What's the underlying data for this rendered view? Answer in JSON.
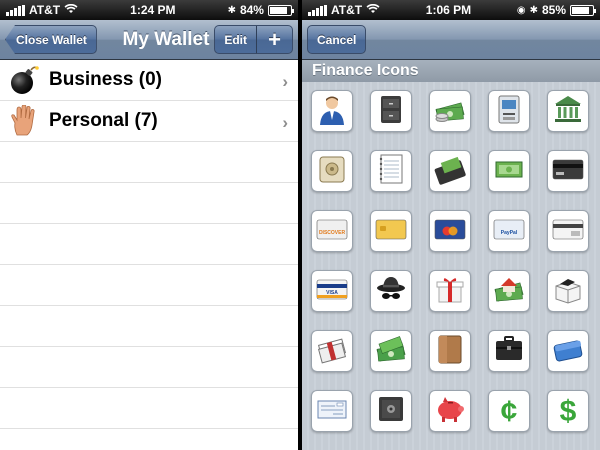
{
  "left": {
    "status": {
      "carrier": "AT&T",
      "time": "1:24 PM",
      "battery": "84%",
      "battery_level": 0.84
    },
    "nav": {
      "back_label": "Close Wallet",
      "title": "My Wallet",
      "edit_label": "Edit",
      "add_label": "+"
    },
    "rows": [
      {
        "label": "Business (0)",
        "icon": "bomb-icon"
      },
      {
        "label": "Personal (7)",
        "icon": "hand-icon"
      }
    ]
  },
  "right": {
    "status": {
      "carrier": "AT&T",
      "time": "1:06 PM",
      "battery": "85%",
      "battery_level": 0.85
    },
    "nav": {
      "cancel_label": "Cancel"
    },
    "section_title": "Finance Icons",
    "icons": [
      "businessman-icon",
      "safe-cabinet-icon",
      "money-coins-icon",
      "atm-icon",
      "bank-icon",
      "vault-icon",
      "ledger-icon",
      "wallet-card-icon",
      "cash-bill-icon",
      "credit-card-dark-icon",
      "discover-card-icon",
      "gold-card-icon",
      "mastercard-icon",
      "paypal-card-icon",
      "card-reader-icon",
      "visa-card-icon",
      "spy-hat-icon",
      "gift-box-icon",
      "house-money-icon",
      "open-box-icon",
      "cash-bundle-icon",
      "money-stack-icon",
      "brown-wallet-icon",
      "briefcase-icon",
      "blue-wallet-icon",
      "check-icon",
      "strongbox-icon",
      "piggy-bank-icon",
      "cent-sign-icon",
      "dollar-sign-icon"
    ],
    "card_texts": {
      "discover": "DISCOVER",
      "visa": "VISA",
      "paypal": "PayPal"
    }
  }
}
